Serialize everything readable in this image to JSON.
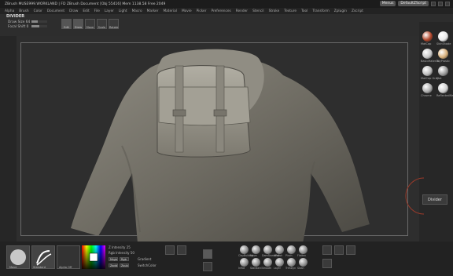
{
  "titlebar": {
    "title": "ZBrush  MUSE999.WORKLAND | FD  ZBrush Document  [Obj 55416]  Mem 1138.58  Free 2049",
    "menu_label": "Menus",
    "script_label": "DefaultZScript"
  },
  "menubar": {
    "items": [
      "Alpha",
      "Brush",
      "Color",
      "Document",
      "Draw",
      "Edit",
      "File",
      "Layer",
      "Light",
      "Macro",
      "Marker",
      "Material",
      "Movie",
      "Picker",
      "Preferences",
      "Render",
      "Stencil",
      "Stroke",
      "Texture",
      "Tool",
      "Transform",
      "Zplugin",
      "Zscript"
    ]
  },
  "toolbar": {
    "title": "DIVIDER",
    "draw_size_label": "Draw Size 64",
    "focal_shift_label": "Focal Shift 0",
    "draw_size_level": 0.4,
    "focal_shift_level": 0.5,
    "buttons": [
      "Edit",
      "Draw",
      "Move",
      "Scale",
      "Rotate"
    ]
  },
  "materials": [
    {
      "name": "MatCap",
      "color": "#b0452a"
    },
    {
      "name": "SkinShade",
      "color": "#e8e8e8"
    },
    {
      "name": "BasicMaterial",
      "color": "#c8c8c8"
    },
    {
      "name": "ToyPlastic",
      "color": "#d8b07a"
    },
    {
      "name": "MatCap Gray",
      "color": "#bbbbbb"
    },
    {
      "name": "Flat",
      "color": "#999999"
    },
    {
      "name": "Chrome",
      "color": "#aaaaaa"
    },
    {
      "name": "ReflectedMap",
      "color": "#cfcfcf"
    }
  ],
  "divider_label": "Divider",
  "bottom": {
    "brush_labels": [
      "Move",
      "Standard",
      "Alpha Off"
    ],
    "z_intensity_label": "Z Intensity 25",
    "rgb_intensity_label": "Rgb Intensity 50",
    "mrgb_label": "Mrgb",
    "rgb_label": "Rgb",
    "zadd_label": "Zadd",
    "zsub_label": "Zsub",
    "gradient_label": "Gradient",
    "switch_label": "SwitchColor",
    "brush_balls": [
      "ClayBuildup",
      "Move",
      "DamStandard",
      "hPolish",
      "Pinch",
      "Flatten",
      "Inflat",
      "Standard",
      "Smooth",
      "Layer",
      "TrimDyn",
      "Slash"
    ]
  },
  "icons": [
    "brush-icon",
    "alpha-icon",
    "color-picker-icon"
  ]
}
